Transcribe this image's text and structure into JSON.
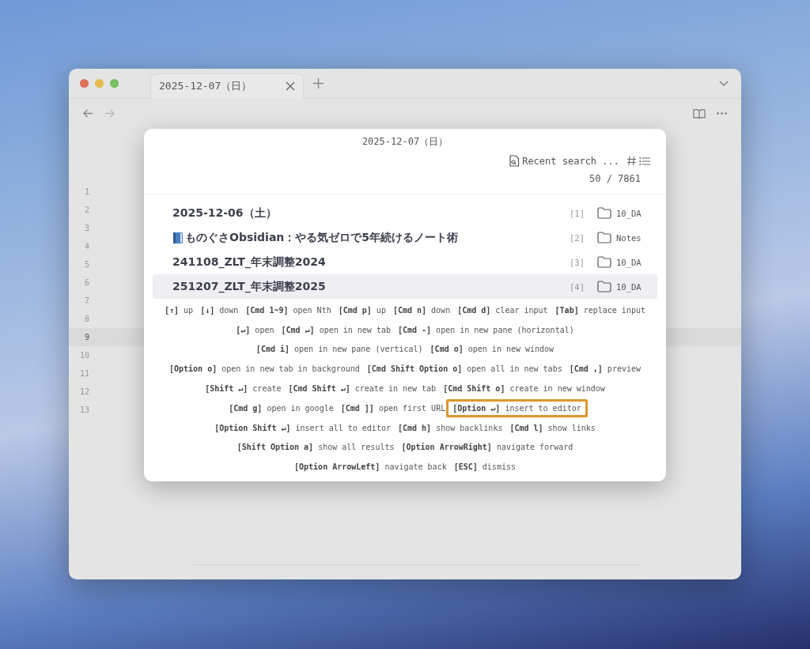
{
  "tab": {
    "title": "2025-12-07（日）",
    "selected": true
  },
  "line_numbers": [
    {
      "n": "1",
      "active": false
    },
    {
      "n": "2",
      "active": false
    },
    {
      "n": "3",
      "active": false
    },
    {
      "n": "4",
      "active": false
    },
    {
      "n": "5",
      "active": false
    },
    {
      "n": "6",
      "active": false
    },
    {
      "n": "7",
      "active": false
    },
    {
      "n": "8",
      "active": false
    },
    {
      "n": "9",
      "active": true
    },
    {
      "n": "10",
      "active": false
    },
    {
      "n": "11",
      "active": false
    },
    {
      "n": "12",
      "active": false
    },
    {
      "n": "13",
      "active": false
    }
  ],
  "switcher": {
    "query": "2025-12-07（日）",
    "recent_label": "Recent search ...",
    "count": "50 / 7861",
    "results": [
      {
        "title": "2025-12-06（土）",
        "book_icon": false,
        "index": "[1]",
        "folder": "10_DA",
        "selected": false
      },
      {
        "title": "ものぐさObsidian：やる気ゼロで5年続けるノート術",
        "book_icon": true,
        "index": "[2]",
        "folder": "Notes",
        "selected": false
      },
      {
        "title": "241108_ZLT_年末調整2024",
        "book_icon": false,
        "index": "[3]",
        "folder": "10_DA",
        "selected": false
      },
      {
        "title": "251207_ZLT_年末調整2025",
        "book_icon": false,
        "index": "[4]",
        "folder": "10_DA",
        "selected": true
      }
    ],
    "hint_lines": [
      [
        {
          "key": "[↑]",
          "action": "up",
          "highlighted": false
        },
        {
          "key": "[↓]",
          "action": "down",
          "highlighted": false
        },
        {
          "key": "[Cmd 1~9]",
          "action": "open Nth",
          "highlighted": false
        },
        {
          "key": "[Cmd p]",
          "action": "up",
          "highlighted": false
        },
        {
          "key": "[Cmd n]",
          "action": "down",
          "highlighted": false
        },
        {
          "key": "[Cmd d]",
          "action": "clear input",
          "highlighted": false
        },
        {
          "key": "[Tab]",
          "action": "replace input",
          "highlighted": false
        }
      ],
      [
        {
          "key": "[↵]",
          "action": "open",
          "highlighted": false
        },
        {
          "key": "[Cmd ↵]",
          "action": "open in new tab",
          "highlighted": false
        },
        {
          "key": "[Cmd -]",
          "action": "open in new pane (horizontal)",
          "highlighted": false
        }
      ],
      [
        {
          "key": "[Cmd i]",
          "action": "open in new pane (vertical)",
          "highlighted": false
        },
        {
          "key": "[Cmd o]",
          "action": "open in new window",
          "highlighted": false
        }
      ],
      [
        {
          "key": "[Option o]",
          "action": "open in new tab in background",
          "highlighted": false
        },
        {
          "key": "[Cmd Shift Option o]",
          "action": "open all in new tabs",
          "highlighted": false
        },
        {
          "key": "[Cmd ,]",
          "action": "preview",
          "highlighted": false
        }
      ],
      [
        {
          "key": "[Shift ↵]",
          "action": "create",
          "highlighted": false
        },
        {
          "key": "[Cmd Shift ↵]",
          "action": "create in new tab",
          "highlighted": false
        },
        {
          "key": "[Cmd Shift o]",
          "action": "create in new window",
          "highlighted": false
        }
      ],
      [
        {
          "key": "[Cmd g]",
          "action": "open in google",
          "highlighted": false
        },
        {
          "key": "[Cmd ]]",
          "action": "open first URL",
          "highlighted": false
        },
        {
          "key": "[Option ↵]",
          "action": "insert to editor",
          "highlighted": true
        }
      ],
      [
        {
          "key": "[Option Shift ↵]",
          "action": "insert all to editor",
          "highlighted": false
        },
        {
          "key": "[Cmd h]",
          "action": "show backlinks",
          "highlighted": false
        },
        {
          "key": "[Cmd l]",
          "action": "show links",
          "highlighted": false
        }
      ],
      [
        {
          "key": "[Shift Option a]",
          "action": "show all results",
          "highlighted": false
        },
        {
          "key": "[Option ArrowRight]",
          "action": "navigate forward",
          "highlighted": false
        }
      ],
      [
        {
          "key": "[Option ArrowLeft]",
          "action": "navigate back",
          "highlighted": false
        },
        {
          "key": "[ESC]",
          "action": "dismiss",
          "highlighted": false
        }
      ]
    ]
  }
}
